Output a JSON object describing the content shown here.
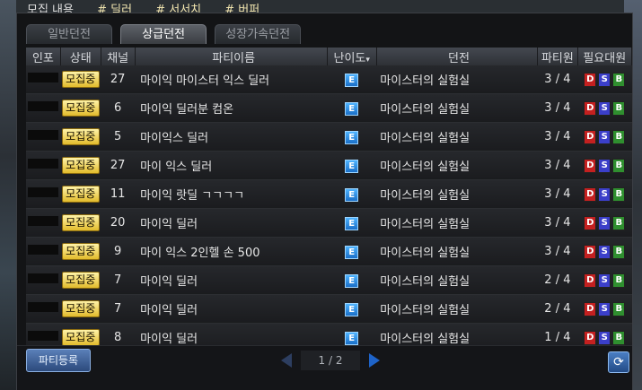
{
  "topbar": {
    "label": "모집 내용",
    "tags": [
      "# 딜러",
      "# 서서치",
      "# 버퍼"
    ]
  },
  "tabs": [
    {
      "label": "일반던전",
      "active": false
    },
    {
      "label": "상급던전",
      "active": true
    },
    {
      "label": "성장가속던전",
      "active": false
    }
  ],
  "columns": {
    "inpo": "인포",
    "status": "상태",
    "channel": "채널",
    "party_name": "파티이름",
    "difficulty": "난이도",
    "dungeon": "던전",
    "party_size": "파티원",
    "required": "필요대원"
  },
  "rows": [
    {
      "status": "모집중",
      "channel": "27",
      "name": "마이익 마이스터 익스 딜러",
      "difficulty": "E",
      "dungeon": "마이스터의 실험실",
      "party": "3 / 4"
    },
    {
      "status": "모집중",
      "channel": "6",
      "name": "마이익 딜러분 컴온",
      "difficulty": "E",
      "dungeon": "마이스터의 실험실",
      "party": "3 / 4"
    },
    {
      "status": "모집중",
      "channel": "5",
      "name": "마이익스 딜러",
      "difficulty": "E",
      "dungeon": "마이스터의 실험실",
      "party": "3 / 4"
    },
    {
      "status": "모집중",
      "channel": "27",
      "name": "마이 익스 딜러",
      "difficulty": "E",
      "dungeon": "마이스터의 실험실",
      "party": "3 / 4"
    },
    {
      "status": "모집중",
      "channel": "11",
      "name": "마이익 랏딜 ㄱㄱㄱㄱ",
      "difficulty": "E",
      "dungeon": "마이스터의 실험실",
      "party": "3 / 4"
    },
    {
      "status": "모집중",
      "channel": "20",
      "name": "마이익 딜러",
      "difficulty": "E",
      "dungeon": "마이스터의 실험실",
      "party": "3 / 4"
    },
    {
      "status": "모집중",
      "channel": "9",
      "name": "마이 익스 2인헬 손 500",
      "difficulty": "E",
      "dungeon": "마이스터의 실험실",
      "party": "3 / 4"
    },
    {
      "status": "모집중",
      "channel": "7",
      "name": "마이익 딜러",
      "difficulty": "E",
      "dungeon": "마이스터의 실험실",
      "party": "2 / 4"
    },
    {
      "status": "모집중",
      "channel": "7",
      "name": "마이익 딜러",
      "difficulty": "E",
      "dungeon": "마이스터의 실험실",
      "party": "2 / 4"
    },
    {
      "status": "모집중",
      "channel": "8",
      "name": "마이익 딜러",
      "difficulty": "E",
      "dungeon": "마이스터의 실험실",
      "party": "1 / 4"
    }
  ],
  "required_roles": [
    "D",
    "S",
    "B"
  ],
  "footer": {
    "register_label": "파티등록",
    "page_label": "1 / 2"
  },
  "colors": {
    "recruit_badge": "#f0d24a",
    "difficulty_e": "#2a8ee8",
    "role_d": "#c42020",
    "role_s": "#3b3fc9",
    "role_b": "#2f8f2f"
  }
}
